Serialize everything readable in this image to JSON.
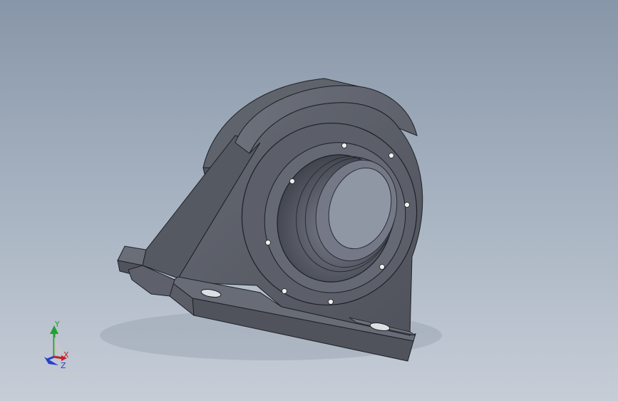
{
  "viewport": {
    "background_top": "#8796a8",
    "background_bottom": "#c6cdd7"
  },
  "model": {
    "part_color": "#5b5e68",
    "edge_color": "#1e2026"
  },
  "triad": {
    "x_label": "X",
    "y_label": "Y",
    "z_label": "Z",
    "x_color": "#c8202a",
    "y_color": "#22a030",
    "z_color": "#2840c8"
  }
}
